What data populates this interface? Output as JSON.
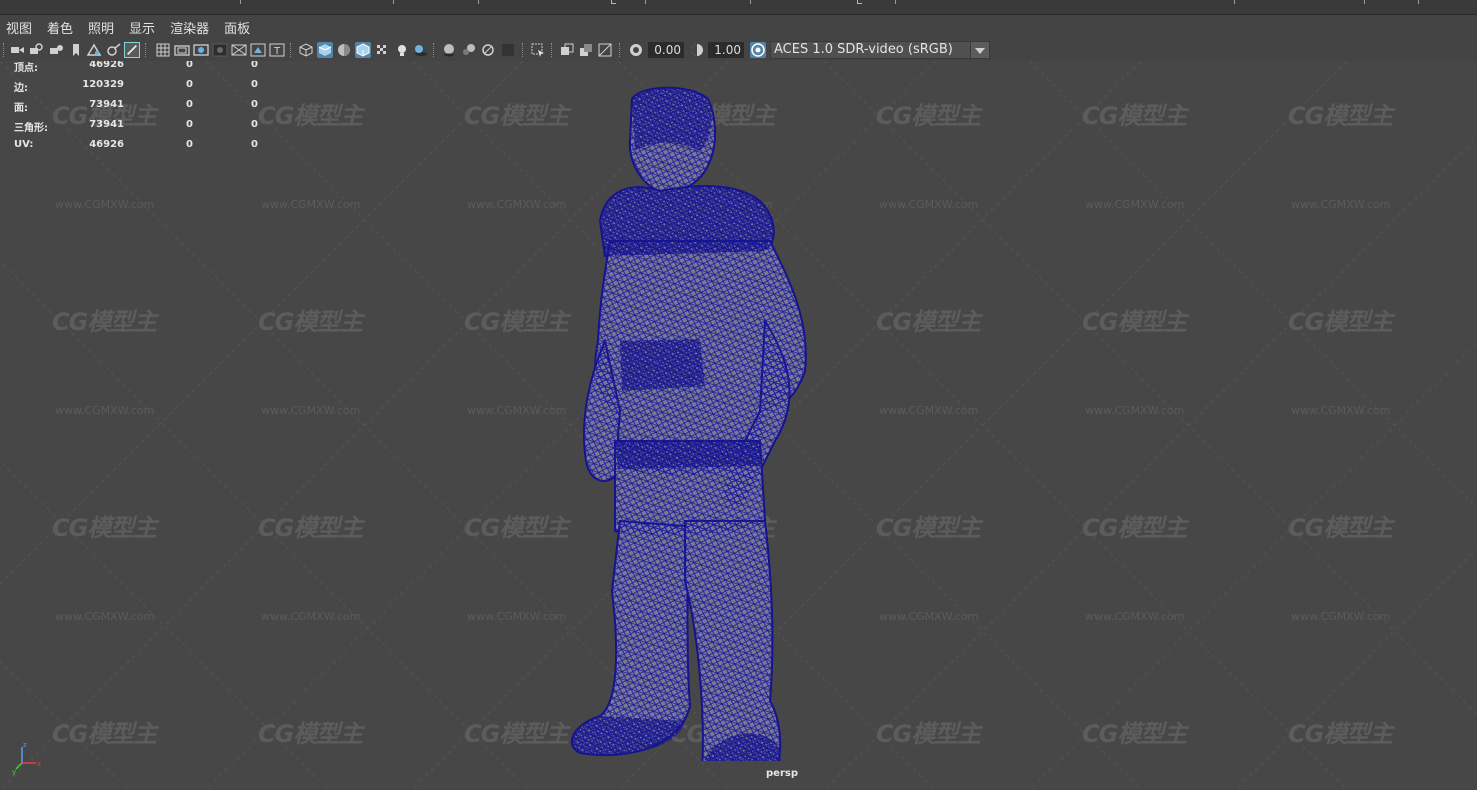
{
  "menu": [
    "视图",
    "着色",
    "照明",
    "显示",
    "渲染器",
    "面板"
  ],
  "toolbar": {
    "exposure": "0.00",
    "gamma": "1.00",
    "colorspace": "ACES 1.0 SDR-video (sRGB)",
    "icons": [
      "camera-select-icon",
      "camera-lock-icon",
      "camera-attributes-icon",
      "bookmark-icon",
      "image-plane-icon",
      "2d-pan-zoom-icon",
      "grease-pencil-icon",
      "grid-icon",
      "film-gate-icon",
      "resolution-gate-icon",
      "gate-mask-icon",
      "field-chart-icon",
      "safe-action-icon",
      "safe-title-icon",
      "wireframe-icon",
      "smooth-shade-icon",
      "default-material-icon",
      "wireframe-on-shaded-icon",
      "xray-icon",
      "use-all-lights-icon",
      "shadows-icon",
      "screen-space-ao-icon",
      "motion-blur-icon",
      "anti-aliasing-icon",
      "depth-of-field-icon",
      "isolate-select-icon",
      "xray-joints-icon",
      "xray-active-icon",
      "backface-cull-icon",
      "exposure-icon",
      "gamma-icon",
      "color-management-icon"
    ]
  },
  "hud": {
    "rows": [
      {
        "label": "顶点:",
        "v1": "46926",
        "v2": "0",
        "v3": "0"
      },
      {
        "label": "边:",
        "v1": "120329",
        "v2": "0",
        "v3": "0"
      },
      {
        "label": "面:",
        "v1": "73941",
        "v2": "0",
        "v3": "0"
      },
      {
        "label": "三角形:",
        "v1": "73941",
        "v2": "0",
        "v3": "0"
      },
      {
        "label": "UV:",
        "v1": "46926",
        "v2": "0",
        "v3": "0"
      }
    ]
  },
  "camera_label": "persp",
  "watermark": {
    "logo": "CG模型主",
    "url": "www.CGMXW.com"
  },
  "colors": {
    "viewport_bg": "#474747",
    "wireframe": "#1c1aa0",
    "selected_button": "#5285a6"
  }
}
